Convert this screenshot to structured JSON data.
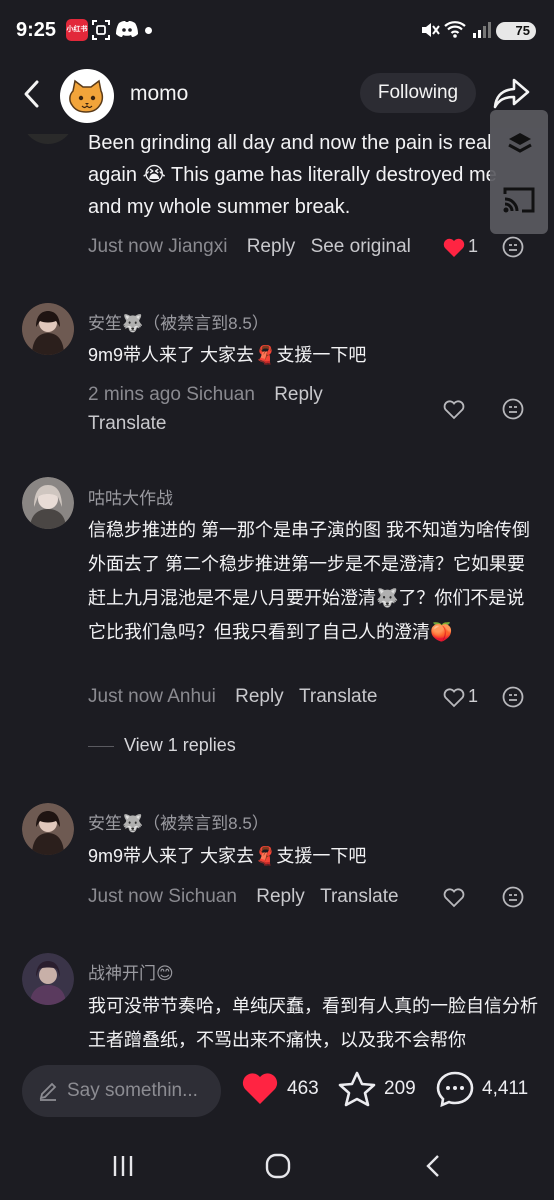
{
  "status_bar": {
    "time": "9:25",
    "battery": "75",
    "app_badge": "小红书"
  },
  "header": {
    "name": "momo",
    "follow_label": "Following"
  },
  "comments": [
    {
      "text": "Been grinding all day and now the pain is real again 😭 This game has literally destroyed me and my whole summer break.",
      "time": "Just now",
      "location": "Jiangxi",
      "reply": "Reply",
      "translate": "See original",
      "likes": "1",
      "liked": true
    },
    {
      "user": "安笙🐺（被禁言到8.5）",
      "text": "9m9带人来了 大家去🧣支援一下吧",
      "time": "2 mins ago",
      "location": "Sichuan",
      "reply": "Reply",
      "translate": "Translate"
    },
    {
      "user": "咕咕大作战",
      "text": "信稳步推进的 第一那个是串子演的图 我不知道为啥传倒外面去了 第二个稳步推进第一步是不是澄清？它如果要赶上九月混池是不是八月要开始澄清🐺了？你们不是说它比我们急吗？但我只看到了自己人的澄清🍑",
      "time": "Just now",
      "location": "Anhui",
      "reply": "Reply",
      "translate": "Translate",
      "likes": "1",
      "view_replies": "View 1 replies"
    },
    {
      "user": "安笙🐺（被禁言到8.5）",
      "text": "9m9带人来了 大家去🧣支援一下吧",
      "time": "Just now",
      "location": "Sichuan",
      "reply": "Reply",
      "translate": "Translate"
    },
    {
      "user": "战神开门😊",
      "text": "我可没带节奏哈，单纯厌蠢，看到有人真的一脸自信分析王者蹭叠纸，不骂出来不痛快，以及我不会帮你"
    }
  ],
  "bottom": {
    "placeholder": "Say somethin...",
    "likes": "463",
    "stars": "209",
    "comments": "4,411"
  },
  "colors": {
    "background": "#1c1c22",
    "like_red": "#ff2442",
    "text": "#f2f2f4",
    "muted": "#8a8a90"
  }
}
